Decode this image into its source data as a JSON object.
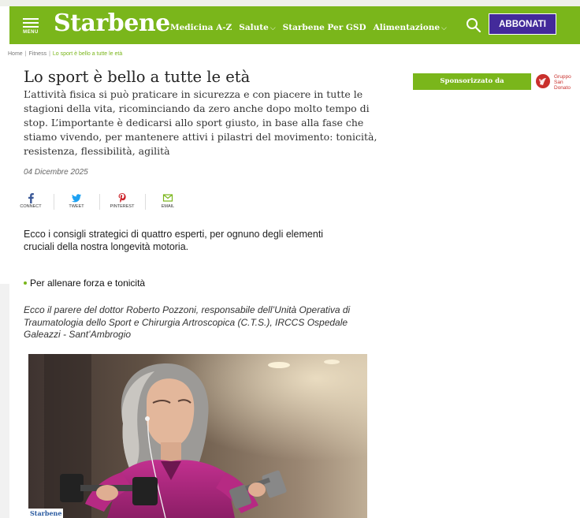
{
  "header": {
    "menu_label": "MENU",
    "logo": "Starbene",
    "nav": [
      {
        "label": "Medicina A-Z",
        "has_dropdown": false
      },
      {
        "label": "Salute",
        "has_dropdown": true
      },
      {
        "label": "Starbene Per GSD",
        "has_dropdown": false
      },
      {
        "label": "Alimentazione",
        "has_dropdown": true
      }
    ],
    "subscribe_label": "ABBONATI",
    "colors": {
      "brand_green": "#7ab61b",
      "subscribe_purple": "#432a9a"
    }
  },
  "breadcrumb": {
    "items": [
      "Home",
      "Fitness",
      "Lo sport è bello a tutte le età"
    ]
  },
  "sponsor": {
    "label": "Sponsorizzato da",
    "logo_line1": "Gruppo",
    "logo_line2": "San Donato"
  },
  "article": {
    "title": "Lo sport è bello a tutte le età",
    "subtitle": "L’attività fisica si può praticare in sicurezza e con piacere in tutte le stagioni della vita, ricominciando da zero anche dopo molto tempo di stop. L’importante è dedicarsi allo sport giusto, in base alla fase che stiamo vivendo, per mantenere attivi i pilastri del movimento: tonicità, resistenza, flessibilità, agilità",
    "date": "04 Dicembre 2025",
    "share": [
      {
        "label": "CONNECT",
        "icon": "facebook-icon",
        "color": "#3b5998"
      },
      {
        "label": "TWEET",
        "icon": "twitter-icon",
        "color": "#1da1f2"
      },
      {
        "label": "PINTEREST",
        "icon": "pinterest-icon",
        "color": "#cb2027"
      },
      {
        "label": "EMAIL",
        "icon": "email-icon",
        "color": "#7ab61b"
      }
    ],
    "intro": "Ecco i consigli strategici di quattro esperti, per ognuno degli elementi cruciali della nostra longevità motoria.",
    "section_heading": "Per allenare forza e tonicità",
    "quote": "Ecco il parere del dottor Roberto Pozzoni, responsabile dell’Unità Operativa di Traumatologia dello Sport e Chirurgia Artroscopica (C.T.S.), IRCCS Ospedale Galeazzi - Sant’Ambrogio",
    "photo_watermark": "Starbene"
  }
}
